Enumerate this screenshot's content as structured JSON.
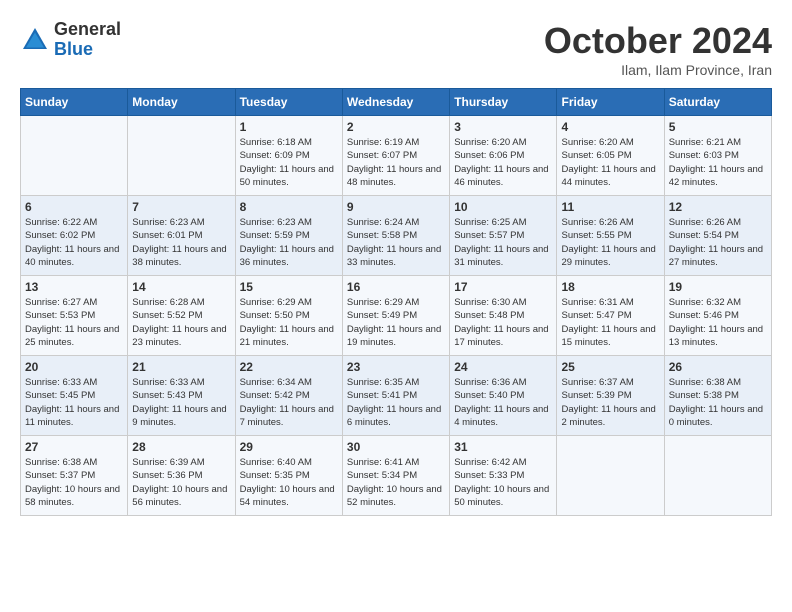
{
  "header": {
    "logo_general": "General",
    "logo_blue": "Blue",
    "month_title": "October 2024",
    "subtitle": "Ilam, Ilam Province, Iran"
  },
  "days_of_week": [
    "Sunday",
    "Monday",
    "Tuesday",
    "Wednesday",
    "Thursday",
    "Friday",
    "Saturday"
  ],
  "weeks": [
    [
      {
        "day": "",
        "content": ""
      },
      {
        "day": "",
        "content": ""
      },
      {
        "day": "1",
        "content": "Sunrise: 6:18 AM\nSunset: 6:09 PM\nDaylight: 11 hours and 50 minutes."
      },
      {
        "day": "2",
        "content": "Sunrise: 6:19 AM\nSunset: 6:07 PM\nDaylight: 11 hours and 48 minutes."
      },
      {
        "day": "3",
        "content": "Sunrise: 6:20 AM\nSunset: 6:06 PM\nDaylight: 11 hours and 46 minutes."
      },
      {
        "day": "4",
        "content": "Sunrise: 6:20 AM\nSunset: 6:05 PM\nDaylight: 11 hours and 44 minutes."
      },
      {
        "day": "5",
        "content": "Sunrise: 6:21 AM\nSunset: 6:03 PM\nDaylight: 11 hours and 42 minutes."
      }
    ],
    [
      {
        "day": "6",
        "content": "Sunrise: 6:22 AM\nSunset: 6:02 PM\nDaylight: 11 hours and 40 minutes."
      },
      {
        "day": "7",
        "content": "Sunrise: 6:23 AM\nSunset: 6:01 PM\nDaylight: 11 hours and 38 minutes."
      },
      {
        "day": "8",
        "content": "Sunrise: 6:23 AM\nSunset: 5:59 PM\nDaylight: 11 hours and 36 minutes."
      },
      {
        "day": "9",
        "content": "Sunrise: 6:24 AM\nSunset: 5:58 PM\nDaylight: 11 hours and 33 minutes."
      },
      {
        "day": "10",
        "content": "Sunrise: 6:25 AM\nSunset: 5:57 PM\nDaylight: 11 hours and 31 minutes."
      },
      {
        "day": "11",
        "content": "Sunrise: 6:26 AM\nSunset: 5:55 PM\nDaylight: 11 hours and 29 minutes."
      },
      {
        "day": "12",
        "content": "Sunrise: 6:26 AM\nSunset: 5:54 PM\nDaylight: 11 hours and 27 minutes."
      }
    ],
    [
      {
        "day": "13",
        "content": "Sunrise: 6:27 AM\nSunset: 5:53 PM\nDaylight: 11 hours and 25 minutes."
      },
      {
        "day": "14",
        "content": "Sunrise: 6:28 AM\nSunset: 5:52 PM\nDaylight: 11 hours and 23 minutes."
      },
      {
        "day": "15",
        "content": "Sunrise: 6:29 AM\nSunset: 5:50 PM\nDaylight: 11 hours and 21 minutes."
      },
      {
        "day": "16",
        "content": "Sunrise: 6:29 AM\nSunset: 5:49 PM\nDaylight: 11 hours and 19 minutes."
      },
      {
        "day": "17",
        "content": "Sunrise: 6:30 AM\nSunset: 5:48 PM\nDaylight: 11 hours and 17 minutes."
      },
      {
        "day": "18",
        "content": "Sunrise: 6:31 AM\nSunset: 5:47 PM\nDaylight: 11 hours and 15 minutes."
      },
      {
        "day": "19",
        "content": "Sunrise: 6:32 AM\nSunset: 5:46 PM\nDaylight: 11 hours and 13 minutes."
      }
    ],
    [
      {
        "day": "20",
        "content": "Sunrise: 6:33 AM\nSunset: 5:45 PM\nDaylight: 11 hours and 11 minutes."
      },
      {
        "day": "21",
        "content": "Sunrise: 6:33 AM\nSunset: 5:43 PM\nDaylight: 11 hours and 9 minutes."
      },
      {
        "day": "22",
        "content": "Sunrise: 6:34 AM\nSunset: 5:42 PM\nDaylight: 11 hours and 7 minutes."
      },
      {
        "day": "23",
        "content": "Sunrise: 6:35 AM\nSunset: 5:41 PM\nDaylight: 11 hours and 6 minutes."
      },
      {
        "day": "24",
        "content": "Sunrise: 6:36 AM\nSunset: 5:40 PM\nDaylight: 11 hours and 4 minutes."
      },
      {
        "day": "25",
        "content": "Sunrise: 6:37 AM\nSunset: 5:39 PM\nDaylight: 11 hours and 2 minutes."
      },
      {
        "day": "26",
        "content": "Sunrise: 6:38 AM\nSunset: 5:38 PM\nDaylight: 11 hours and 0 minutes."
      }
    ],
    [
      {
        "day": "27",
        "content": "Sunrise: 6:38 AM\nSunset: 5:37 PM\nDaylight: 10 hours and 58 minutes."
      },
      {
        "day": "28",
        "content": "Sunrise: 6:39 AM\nSunset: 5:36 PM\nDaylight: 10 hours and 56 minutes."
      },
      {
        "day": "29",
        "content": "Sunrise: 6:40 AM\nSunset: 5:35 PM\nDaylight: 10 hours and 54 minutes."
      },
      {
        "day": "30",
        "content": "Sunrise: 6:41 AM\nSunset: 5:34 PM\nDaylight: 10 hours and 52 minutes."
      },
      {
        "day": "31",
        "content": "Sunrise: 6:42 AM\nSunset: 5:33 PM\nDaylight: 10 hours and 50 minutes."
      },
      {
        "day": "",
        "content": ""
      },
      {
        "day": "",
        "content": ""
      }
    ]
  ]
}
